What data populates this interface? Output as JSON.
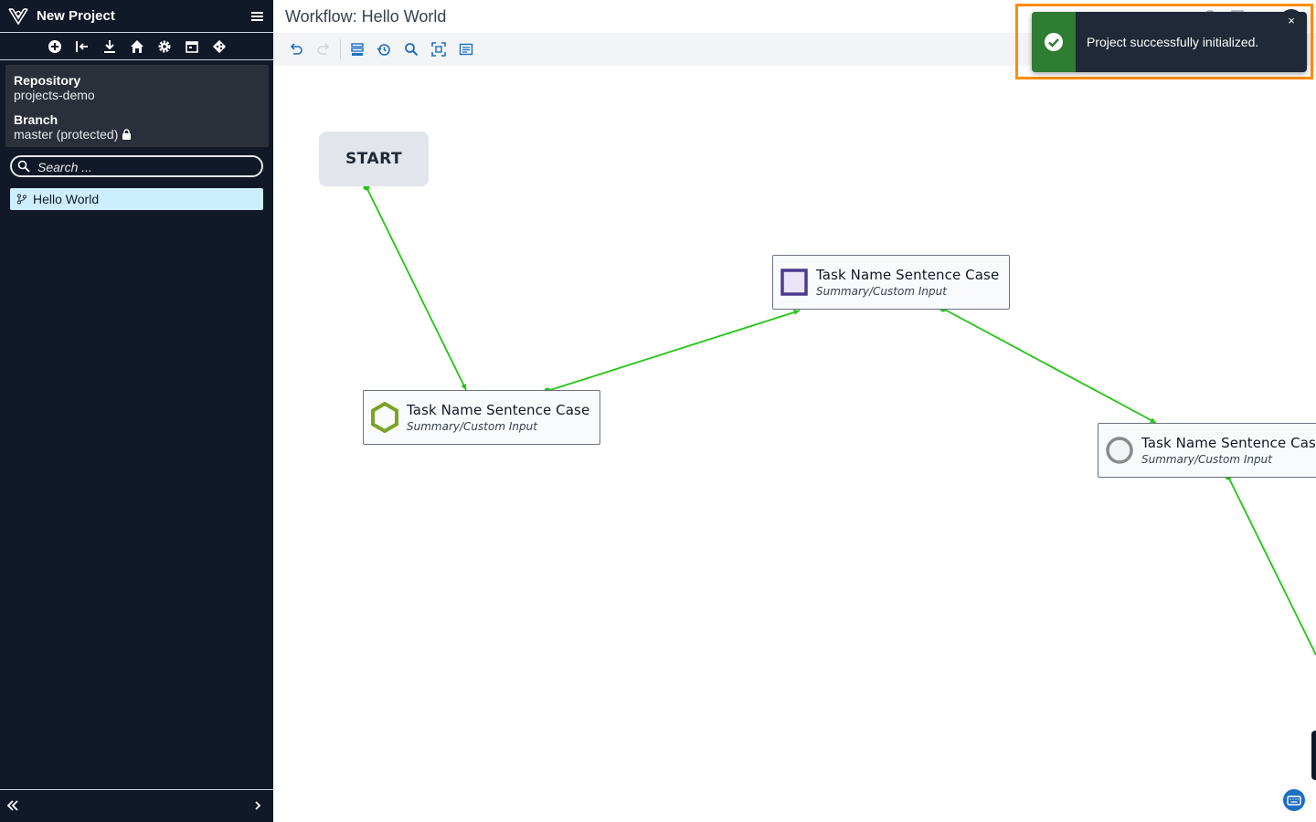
{
  "sidebar": {
    "project_title": "New Project",
    "repository_label": "Repository",
    "repository_value": "projects-demo",
    "branch_label": "Branch",
    "branch_value": "master (protected)",
    "search_placeholder": "Search ...",
    "items": [
      {
        "label": "Hello World",
        "icon": "workflow-icon",
        "selected": true
      }
    ],
    "toolbar_icons": [
      "add-icon",
      "import-icon",
      "download-icon",
      "home-icon",
      "gear-icon",
      "calendar-icon",
      "git-icon"
    ]
  },
  "main": {
    "workflow_title": "Workflow: Hello World",
    "toolbar_icons": [
      "undo-icon",
      "redo-icon",
      "list-icon",
      "history-icon",
      "search-icon",
      "fit-view-icon",
      "notes-icon"
    ]
  },
  "canvas": {
    "start_label": "START",
    "nodes": [
      {
        "title": "Task Name Sentence Case",
        "subtitle": "Summary/Custom Input",
        "icon": "hexagon-icon"
      },
      {
        "title": "Task Name Sentence Case",
        "subtitle": "Summary/Custom Input",
        "icon": "square-icon"
      },
      {
        "title": "Task Name Sentence Case",
        "subtitle": "Summary/Custom Input",
        "icon": "circle-icon"
      }
    ],
    "edge_color": "#22c514"
  },
  "toast": {
    "message": "Project successfully initialized.",
    "close_label": "×",
    "accent_color": "#2e7d32",
    "highlight_color": "#ff8c00"
  },
  "colors": {
    "sidebar_bg": "#111827",
    "selected_item_bg": "#cdeefd",
    "accent": "#1d6fc4"
  }
}
